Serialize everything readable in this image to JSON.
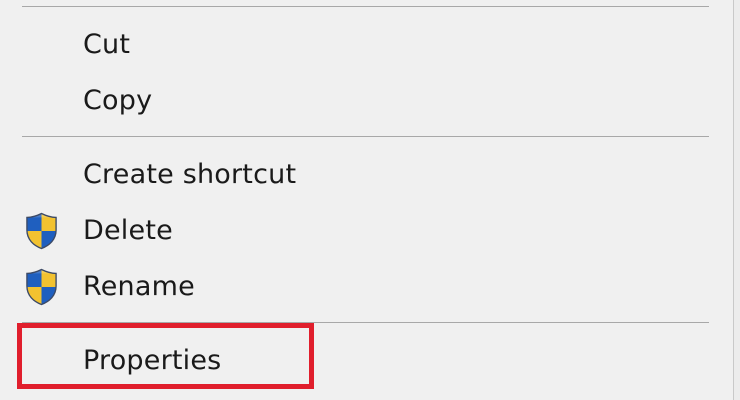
{
  "context_menu": {
    "items": [
      {
        "label": "Cut",
        "icon": null
      },
      {
        "label": "Copy",
        "icon": null
      },
      {
        "label": "Create shortcut",
        "icon": null
      },
      {
        "label": "Delete",
        "icon": "uac-shield-icon"
      },
      {
        "label": "Rename",
        "icon": "uac-shield-icon"
      },
      {
        "label": "Properties",
        "icon": null
      }
    ],
    "highlighted_item": "Properties",
    "colors": {
      "menu_background": "#f0f0f0",
      "separator": "#a8a8a8",
      "text": "#1a1a1a",
      "highlight_border": "#e01e2c",
      "shield_blue": "#1f5fbf",
      "shield_yellow": "#f2c230"
    }
  }
}
